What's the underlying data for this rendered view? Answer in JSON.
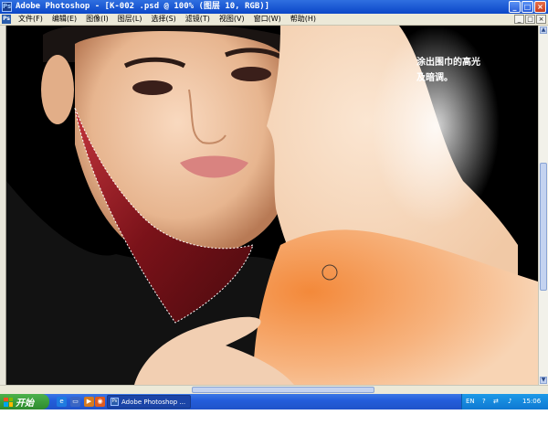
{
  "window": {
    "app_icon": "Ps",
    "title": "Adobe Photoshop - [K-002 .psd @ 100% (图层 10, RGB)]",
    "buttons": {
      "minimize": "_",
      "maximize": "□",
      "close": "×"
    }
  },
  "menubar": {
    "items": [
      "文件(F)",
      "编辑(E)",
      "图像(I)",
      "图层(L)",
      "选择(S)",
      "滤镜(T)",
      "视图(V)",
      "窗口(W)",
      "帮助(H)"
    ],
    "doc_controls": [
      "_",
      "□",
      "×"
    ]
  },
  "canvas": {
    "annotation_line1": "涂出围巾的高光",
    "annotation_line2": "及暗调。"
  },
  "taskbar": {
    "start_label": "开始",
    "quick_launch": [
      "ie-icon",
      "desktop-icon",
      "media-player-icon",
      "firefox-icon"
    ],
    "active_app": "Adobe Photoshop ...",
    "tray_lang": "EN",
    "clock": "15:06"
  },
  "colors": {
    "titlebar": "#0b47c8",
    "menubar": "#ece9d8",
    "taskbar": "#245edb",
    "start_button": "#2d8a2d",
    "scarf": "#8b1a22",
    "skin_orange": "#f0843a"
  }
}
